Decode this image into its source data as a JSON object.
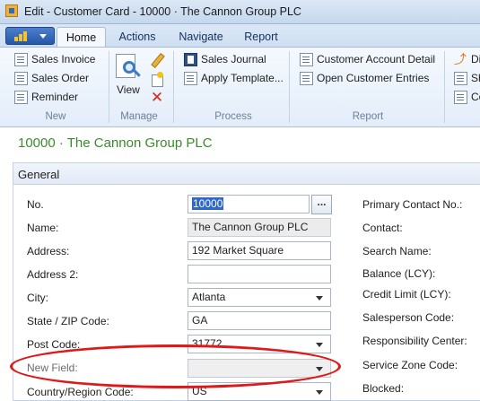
{
  "window": {
    "title": "Edit - Customer Card - 10000 · The Cannon Group PLC"
  },
  "ribbon": {
    "tabs": [
      {
        "label": "Home",
        "active": true
      },
      {
        "label": "Actions"
      },
      {
        "label": "Navigate"
      },
      {
        "label": "Report"
      }
    ],
    "new_group": {
      "label": "New",
      "items": [
        {
          "label": "Sales Invoice",
          "icon": "document-icon"
        },
        {
          "label": "Sales Order",
          "icon": "document-icon"
        },
        {
          "label": "Reminder",
          "icon": "document-icon"
        }
      ]
    },
    "manage_group": {
      "label": "Manage",
      "view_label": "View",
      "icons": [
        "edit-pencil-icon",
        "new-record-icon",
        "delete-icon"
      ]
    },
    "process_group": {
      "label": "Process",
      "items": [
        {
          "label": "Sales Journal",
          "icon": "journal-icon"
        },
        {
          "label": "Apply Template...",
          "icon": "template-icon"
        }
      ]
    },
    "report_group": {
      "label": "Report",
      "items": [
        {
          "label": "Customer Account Detail",
          "icon": "report-icon"
        },
        {
          "label": "Open Customer Entries",
          "icon": "report-icon"
        }
      ]
    },
    "overflow_group": {
      "items": [
        {
          "label": "Di"
        },
        {
          "label": "Sh"
        },
        {
          "label": "Co"
        }
      ]
    }
  },
  "card": {
    "heading": "10000 · The Cannon Group PLC",
    "fasttab_title": "General",
    "fields": [
      {
        "label": "No.",
        "value": "10000"
      },
      {
        "label": "Name:",
        "value": "The Cannon Group PLC"
      },
      {
        "label": "Address:",
        "value": "192 Market Square"
      },
      {
        "label": "Address 2:",
        "value": ""
      },
      {
        "label": "City:",
        "value": "Atlanta"
      },
      {
        "label": "State / ZIP Code:",
        "value": "GA"
      },
      {
        "label": "Post Code:",
        "value": "31772"
      },
      {
        "label": "New Field:",
        "value": ""
      },
      {
        "label": "Country/Region Code:",
        "value": "US"
      }
    ],
    "assist_button_label": "...",
    "right_labels": [
      "Primary Contact No.:",
      "Contact:",
      "Search Name:",
      "Balance (LCY):",
      "Credit Limit (LCY):",
      "Salesperson Code:",
      "Responsibility Center:",
      "Service Zone Code:",
      "Blocked:"
    ]
  },
  "colors": {
    "heading": "#3c8a2e",
    "annotation": "#e01818",
    "selection": "#3068c8"
  }
}
